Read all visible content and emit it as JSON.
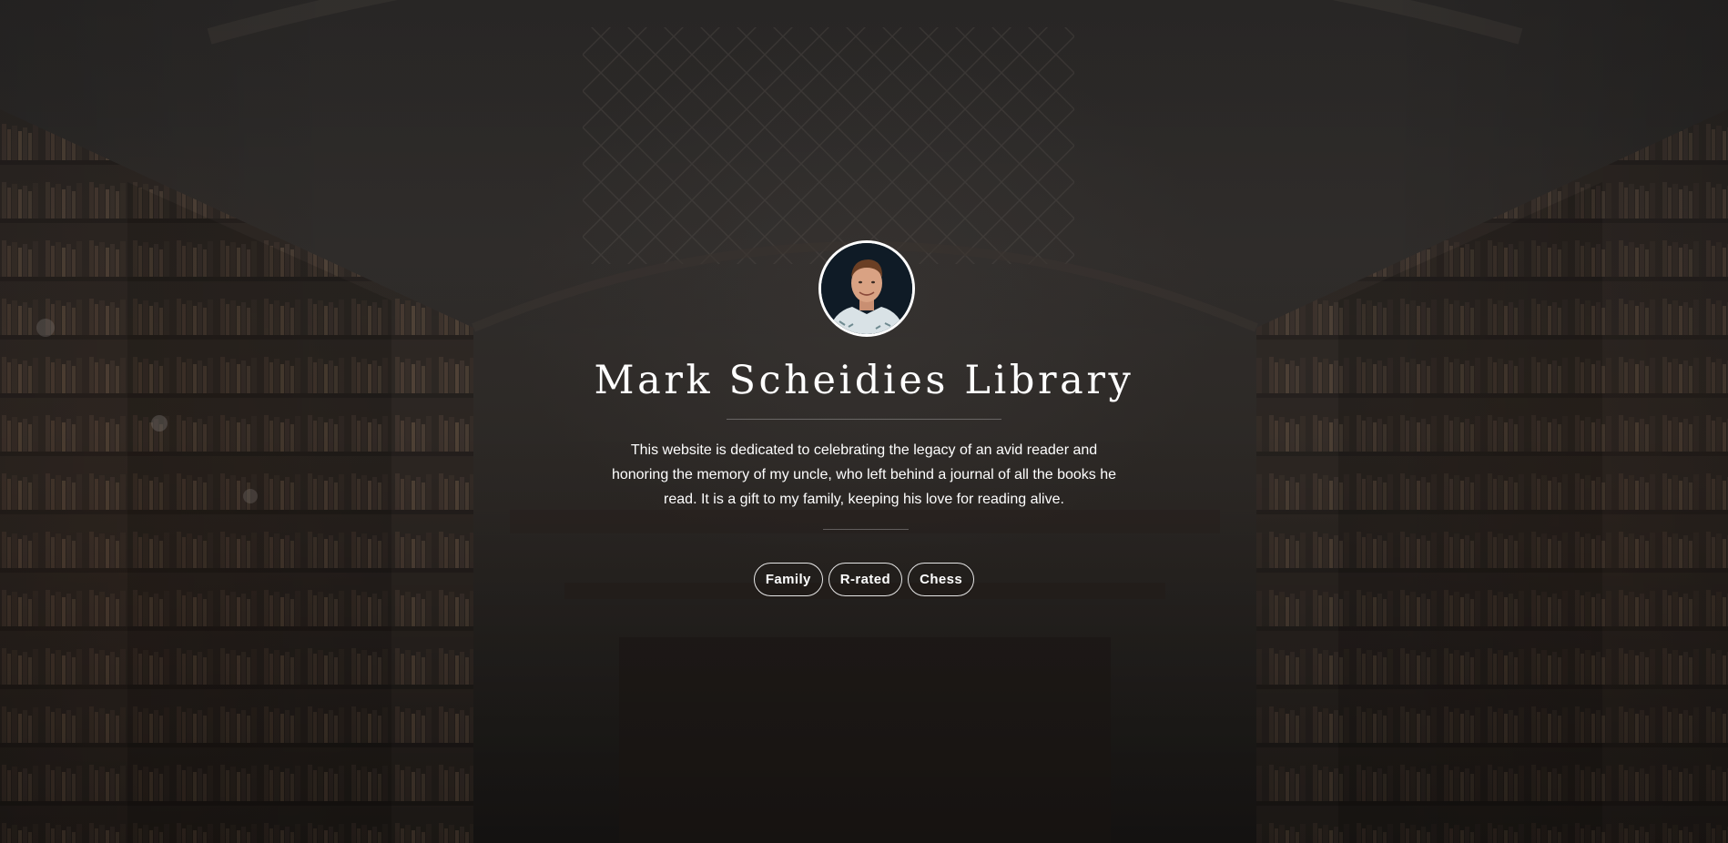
{
  "hero": {
    "background": "library-interior-photo",
    "avatar": {
      "icon": "portrait-photo",
      "border_color": "#ffffff"
    },
    "title": "Mark Scheidies Library",
    "description": "This website is dedicated to celebrating the legacy of an avid reader and honoring the memory of my uncle, who left behind a journal of all the books he read. It is a gift to my family, keeping his love for reading alive.",
    "tags": [
      {
        "label": "Family"
      },
      {
        "label": "R-rated"
      },
      {
        "label": "Chess"
      }
    ]
  },
  "colors": {
    "text": "#ffffff",
    "background_dark": "#1e1c1b",
    "tag_border": "#e6e6e6"
  }
}
